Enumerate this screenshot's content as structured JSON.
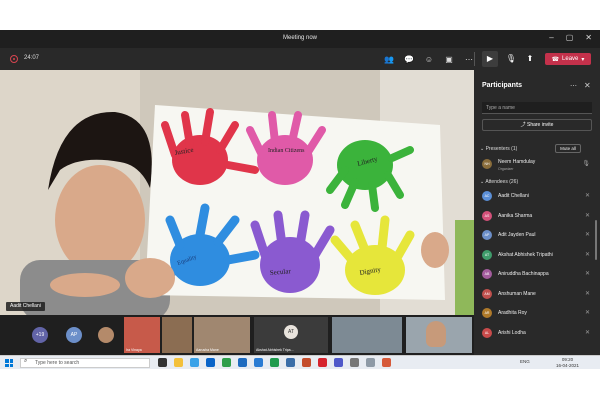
{
  "window": {
    "title": "Meeting now"
  },
  "toolbar": {
    "timer": "24:07",
    "leave_label": "Leave",
    "buttons": [
      {
        "name": "participants-button",
        "icon": "people-icon",
        "glyph": "👥"
      },
      {
        "name": "chat-button",
        "icon": "chat-icon",
        "glyph": "💬"
      },
      {
        "name": "reactions-button",
        "icon": "reactions-icon",
        "glyph": "☺"
      },
      {
        "name": "rooms-button",
        "icon": "rooms-icon",
        "glyph": "▣"
      },
      {
        "name": "more-actions-button",
        "icon": "more-icon",
        "glyph": "⋯"
      }
    ],
    "accent_leave": "#c4314b"
  },
  "stage": {
    "speaker_name": "Aadit Chellani",
    "drawing_words": [
      "Justice",
      "Indian Citizens",
      "Liberty",
      "Equality",
      "Secular",
      "Dignity"
    ]
  },
  "panel": {
    "title": "Participants",
    "search_placeholder": "Type a name",
    "share_invite_label": "Share invite",
    "presenters_label": "Presenters (1)",
    "mute_all_label": "Mute all",
    "attendees_label": "Attendees (26)",
    "presenters": [
      {
        "name": "Neem Hamdulay",
        "role": "Organizer",
        "initials": "NH",
        "color": "#8a6d3b"
      }
    ],
    "attendees": [
      {
        "name": "Aadit Chellani",
        "initials": "AC",
        "color": "#5b8fd6"
      },
      {
        "name": "Aanika Sharma",
        "initials": "AS",
        "color": "#d4517a"
      },
      {
        "name": "Adit Jayden Paul",
        "initials": "AP",
        "color": "#6c8fc9"
      },
      {
        "name": "Akshat Abhishek Tripathi",
        "initials": "AT",
        "color": "#3f9c6b"
      },
      {
        "name": "Aniruddha Bachinappa",
        "initials": "AB",
        "color": "#a35c9d"
      },
      {
        "name": "Anshuman Mane",
        "initials": "AM",
        "color": "#c0504d"
      },
      {
        "name": "Aradhita Roy",
        "initials": "AR",
        "color": "#b07a2a"
      },
      {
        "name": "Arishi Lodha",
        "initials": "AL",
        "color": "#c94b4b"
      }
    ]
  },
  "strip": {
    "overflow_count": "+19",
    "avatars": [
      {
        "initials": "AP",
        "color": "#6c8fc9"
      }
    ],
    "thumbs": [
      {
        "label": "Ira Vinaya"
      },
      {
        "label": "Aarusha Mane"
      },
      {
        "label": "Akshat Abhishek Tripa..."
      },
      {
        "label": ""
      },
      {
        "label": ""
      }
    ],
    "tile_initials": "AT"
  },
  "taskbar": {
    "search_placeholder": "Type here to search",
    "language": "ENG",
    "time": "09:20",
    "date": "16-04-2021"
  }
}
